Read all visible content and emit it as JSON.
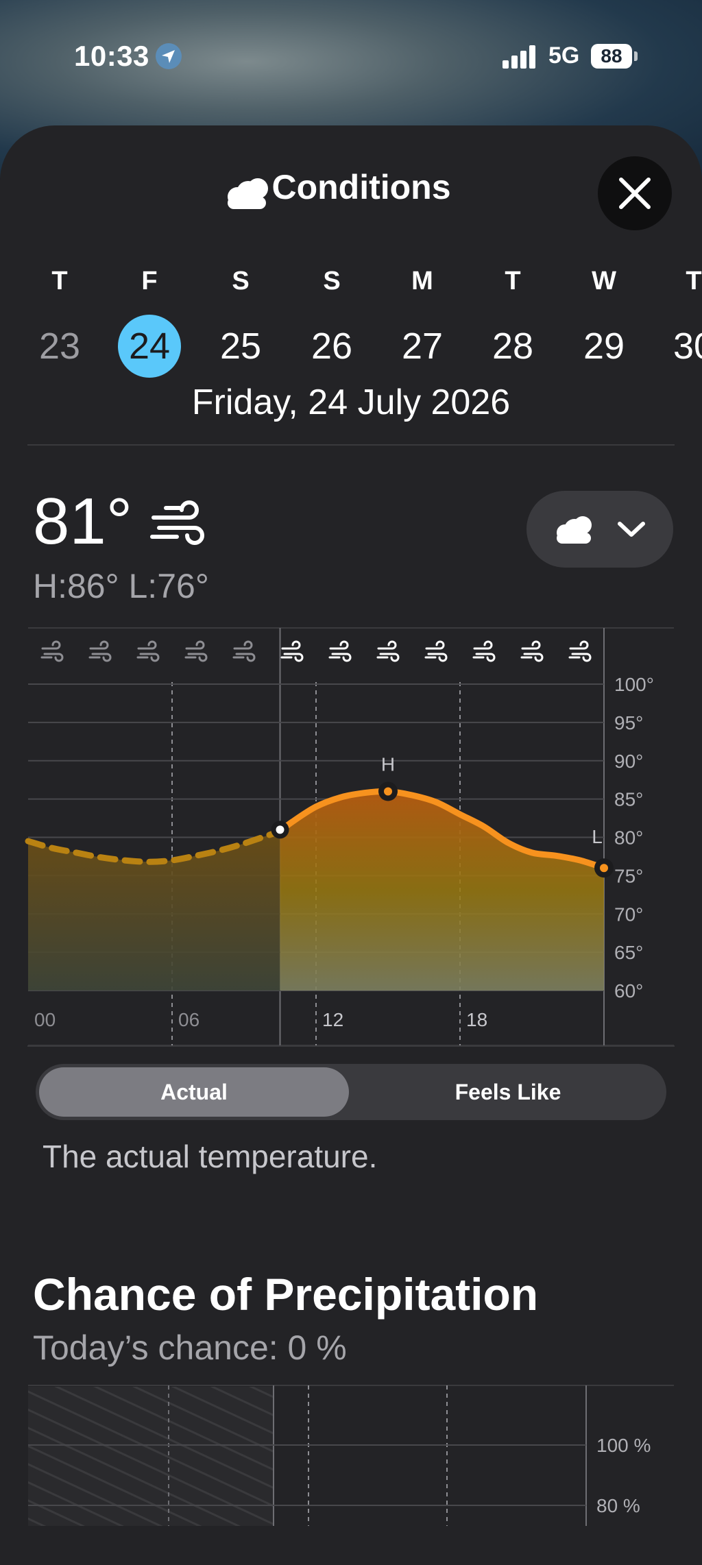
{
  "status_bar": {
    "time": "10:33",
    "network": "5G",
    "battery": "88",
    "icons": [
      "location-arrow-icon",
      "signal-bars-icon"
    ]
  },
  "header": {
    "title": "Conditions",
    "icon": "cloud-icon",
    "close_icon": "close-icon"
  },
  "days": [
    {
      "letter": "T",
      "num": "23"
    },
    {
      "letter": "F",
      "num": "24"
    },
    {
      "letter": "S",
      "num": "25"
    },
    {
      "letter": "S",
      "num": "26"
    },
    {
      "letter": "M",
      "num": "27"
    },
    {
      "letter": "T",
      "num": "28"
    },
    {
      "letter": "W",
      "num": "29"
    },
    {
      "letter": "T",
      "num": "30"
    }
  ],
  "selected_date": "Friday, 24 July 2026",
  "current": {
    "temp": "81°",
    "high_low": "H:86° L:76°",
    "condition_icon": "wind-icon",
    "selector_icon": "cloud-icon"
  },
  "chart_data": {
    "type": "area",
    "x_ticks": [
      "00",
      "06",
      "12",
      "18"
    ],
    "y_ticks": [
      "100°",
      "95°",
      "90°",
      "85°",
      "80°",
      "75°",
      "70°",
      "65°",
      "60°"
    ],
    "ylim": [
      60,
      100
    ],
    "xlim": [
      0,
      24
    ],
    "marker_labels": {
      "high": "H",
      "low": "L"
    },
    "series": [
      {
        "x": [
          0,
          1,
          2,
          3,
          4,
          5,
          6,
          7,
          8,
          9,
          10.5
        ],
        "values": [
          79.5,
          78.6,
          78.0,
          77.4,
          77.0,
          76.8,
          77.0,
          77.6,
          78.3,
          79.2,
          80.8
        ],
        "style": "dashed"
      },
      {
        "x": [
          10.5,
          11,
          12,
          13,
          14,
          15,
          16,
          17,
          18,
          19,
          20,
          21,
          22,
          23,
          24
        ],
        "values": [
          80.8,
          82.0,
          84.0,
          85.2,
          85.8,
          86.0,
          85.5,
          84.6,
          83.0,
          81.4,
          79.3,
          78.0,
          77.6,
          77.0,
          76.0
        ],
        "style": "solid"
      }
    ],
    "markers": [
      {
        "x": 10.5,
        "value": 81,
        "kind": "current"
      },
      {
        "x": 15,
        "value": 86,
        "kind": "high"
      },
      {
        "x": 24,
        "value": 76,
        "kind": "low"
      }
    ],
    "wind_icons": 12,
    "colors": {
      "line": "#f7921e",
      "past_line": "#b98212"
    }
  },
  "segmented": {
    "options": [
      "Actual",
      "Feels Like"
    ],
    "selected": "Actual"
  },
  "description": "The actual temperature.",
  "precipitation": {
    "title": "Chance of Precipitation",
    "subtitle": "Today’s chance: 0 %",
    "y_ticks": [
      "100 %",
      "80 %"
    ]
  }
}
